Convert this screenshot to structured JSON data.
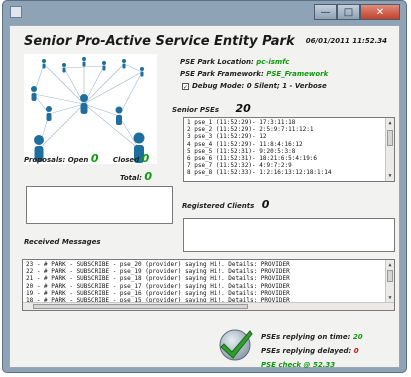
{
  "window": {
    "title": ""
  },
  "header": {
    "title": "Senior Pro-Active Service Entity Park",
    "datetime": "06/01/2011 11:52.34"
  },
  "park": {
    "location_label": "PSE Park Location:",
    "location_value": "pc-ismfc",
    "framework_label": "PSE Park Framework:",
    "framework_value": "PSE_Framework",
    "debug_label": "Debug Mode: 0 Silent; 1 - Verbose",
    "debug_checked": true
  },
  "proposals": {
    "open_label": "Proposals:  Open",
    "open_value": "0",
    "closed_label": "Closed",
    "closed_value": "0",
    "total_label": "Total:",
    "total_value": "0"
  },
  "senior_pses": {
    "label": "Senior PSEs",
    "count": "20",
    "items": [
      "1 pse_1 (11:52:29)- 17:3:11:18",
      "2 pse_2 (11:52:29)- 2:5:9:7:11:12:1",
      "3 pse_3 (11:52:29)- 12",
      "4 pse_4 (11:52:29)- 11:8:4:16:12",
      "5 pse_5 (11:52:31)- 9:20:5:3:8",
      "6 pse_6 (11:52:31)- 18:21:6:5:4:19:6",
      "7 pse_7 (11:52:32)- 4:9:7:2:9",
      "8 pse_8 (11:52:33)- 1:2:16:13:12:18:1:14"
    ]
  },
  "registered_clients": {
    "label": "Registered Clients",
    "count": "0"
  },
  "received_messages": {
    "label": "Received Messages",
    "items": [
      "23 - # PARK - SUBSCRIBE - pse_20 (provider) saying Hi!. Details: PROVIDER",
      "22 - # PARK - SUBSCRIBE - pse_19 (provider) saying Hi!. Details: PROVIDER",
      "21 - # PARK - SUBSCRIBE - pse_18 (provider) saying Hi!. Details: PROVIDER",
      "20 - # PARK - SUBSCRIBE - pse_17 (provider) saying Hi!. Details: PROVIDER",
      "19 - # PARK - SUBSCRIBE - pse_16 (provider) saying Hi!. Details: PROVIDER",
      "18 - # PARK - SUBSCRIBE - pse_15 (provider) saying Hi!. Details: PROVIDER"
    ]
  },
  "status": {
    "on_time_label": "PSEs replying on time:",
    "on_time_value": "20",
    "delayed_label": "PSEs replying delayed:",
    "delayed_value": "0",
    "check_label": "PSE check @ 52.33"
  },
  "colors": {
    "accent_green": "#0c9a0c",
    "delayed_red": "#d01010",
    "titlebar": "#8fa3b6",
    "network_node": "#1f6f9e"
  }
}
